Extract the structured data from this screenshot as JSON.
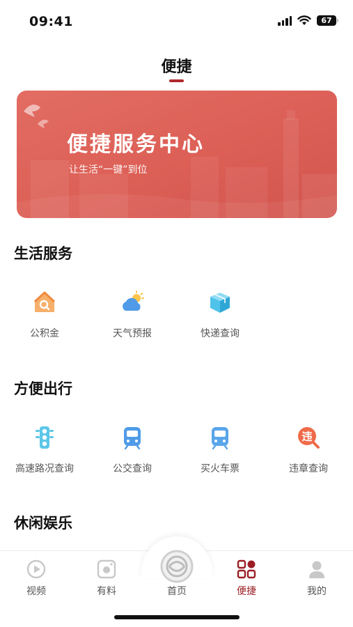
{
  "status_bar": {
    "time": "09:41",
    "battery": "67"
  },
  "header": {
    "title": "便捷"
  },
  "banner": {
    "title": "便捷服务中心",
    "subtitle": "让生活“一键”到位"
  },
  "sections": [
    {
      "title": "生活服务",
      "items": [
        {
          "label": "公积金",
          "icon": "house-search-icon"
        },
        {
          "label": "天气预报",
          "icon": "weather-icon"
        },
        {
          "label": "快递查询",
          "icon": "package-icon"
        }
      ]
    },
    {
      "title": "方便出行",
      "items": [
        {
          "label": "高速路况查询",
          "icon": "traffic-light-icon"
        },
        {
          "label": "公交查询",
          "icon": "bus-icon"
        },
        {
          "label": "买火车票",
          "icon": "train-icon"
        },
        {
          "label": "违章查询",
          "icon": "violation-icon"
        }
      ]
    },
    {
      "title": "休闲娱乐",
      "items": []
    }
  ],
  "tab_bar": {
    "items": [
      {
        "label": "视频",
        "icon": "video-icon"
      },
      {
        "label": "有料",
        "icon": "camera-icon"
      },
      {
        "label": "首页",
        "icon": "home-logo-icon"
      },
      {
        "label": "便捷",
        "icon": "grid-icon",
        "active": true
      },
      {
        "label": "我的",
        "icon": "user-icon"
      }
    ]
  },
  "colors": {
    "accent": "#b0282d",
    "banner": "#dc5f56",
    "active_tab": "#9b1e25"
  }
}
